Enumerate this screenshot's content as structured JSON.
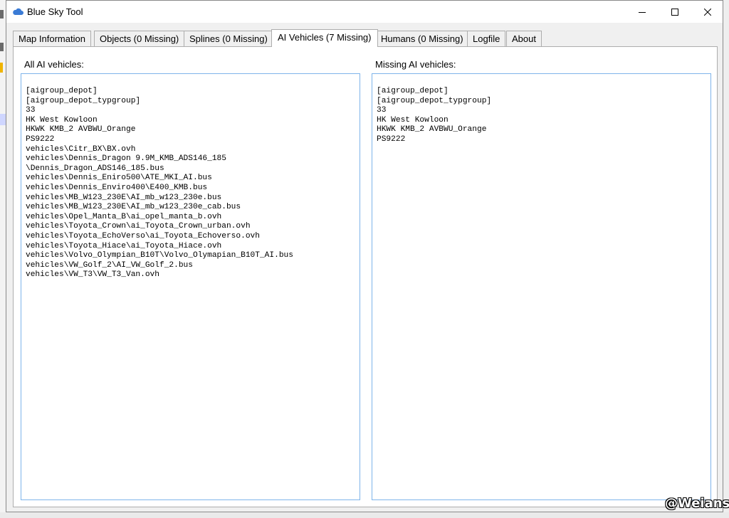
{
  "window": {
    "title": "Blue Sky Tool",
    "accent": "#3a7bd5"
  },
  "tabs": [
    {
      "label": "Map Information"
    },
    {
      "label": "Objects (0 Missing)"
    },
    {
      "label": "Splines (0 Missing)"
    },
    {
      "label": "AI Vehicles (7 Missing)",
      "active": true
    },
    {
      "label": "Humans (0 Missing)"
    },
    {
      "label": "Logfile"
    },
    {
      "label": "About"
    }
  ],
  "panes": {
    "all_label": "All AI vehicles:",
    "missing_label": "Missing AI vehicles:",
    "all_lines": [
      "[aigroup_depot]",
      "[aigroup_depot_typgroup]",
      "33",
      "HK West Kowloon",
      "HKWK KMB_2 AVBWU_Orange",
      "PS9222",
      "vehicles\\Citr_BX\\BX.ovh",
      "vehicles\\Dennis_Dragon 9.9M_KMB_ADS146_185",
      "\\Dennis_Dragon_ADS146_185.bus",
      "vehicles\\Dennis_Eniro500\\ATE_MKI_AI.bus",
      "vehicles\\Dennis_Enviro400\\E400_KMB.bus",
      "vehicles\\MB_W123_230E\\AI_mb_w123_230e.bus",
      "vehicles\\MB_W123_230E\\AI_mb_w123_230e_cab.bus",
      "vehicles\\Opel_Manta_B\\ai_opel_manta_b.ovh",
      "vehicles\\Toyota_Crown\\ai_Toyota_Crown_urban.ovh",
      "vehicles\\Toyota_EchoVerso\\ai_Toyota_Echoverso.ovh",
      "vehicles\\Toyota_Hiace\\ai_Toyota_Hiace.ovh",
      "vehicles\\Volvo_Olympian_B10T\\Volvo_Olymapian_B10T_AI.bus",
      "vehicles\\VW_Golf_2\\AI_VW_Golf_2.bus",
      "vehicles\\VW_T3\\VW_T3_Van.ovh"
    ],
    "missing_lines": [
      "[aigroup_depot]",
      "[aigroup_depot_typgroup]",
      "33",
      "HK West Kowloon",
      "HKWK KMB_2 AVBWU_Orange",
      "PS9222"
    ]
  },
  "watermark": "@Weians"
}
